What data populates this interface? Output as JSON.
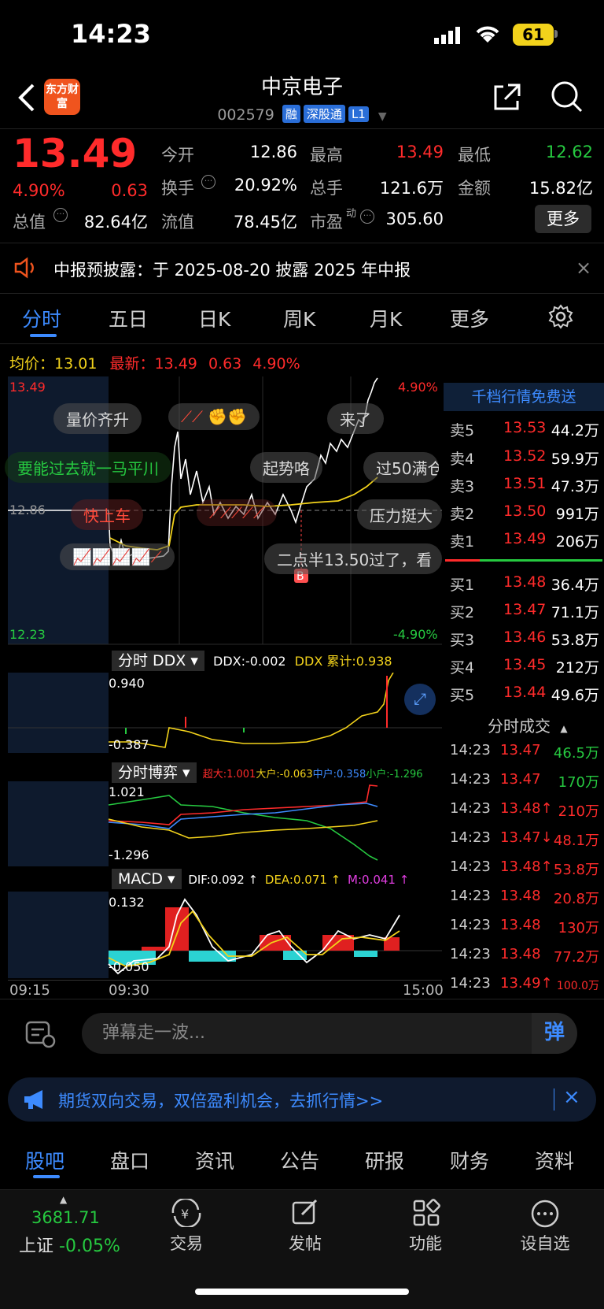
{
  "status": {
    "time": "14:23",
    "battery": "61"
  },
  "header": {
    "logo_text": "东方财富",
    "title": "中京电子",
    "code": "002579",
    "tags": [
      "融",
      "深股通",
      "L1"
    ]
  },
  "quote": {
    "price": "13.49",
    "change_pct": "4.90%",
    "change_amt": "0.63",
    "fields": {
      "open_label": "今开",
      "open": "12.86",
      "high_label": "最高",
      "high": "13.49",
      "low_label": "最低",
      "low": "12.62",
      "turnover_label": "换手",
      "turnover": "20.92%",
      "volume_label": "总手",
      "volume": "121.6万",
      "amount_label": "金额",
      "amount": "15.82亿",
      "mktcap_label": "总值",
      "mktcap": "82.64亿",
      "float_label": "流值",
      "float": "78.45亿",
      "pe_label": "市盈",
      "pe_sup": "动",
      "pe": "305.60"
    },
    "more_label": "更多"
  },
  "notice": {
    "text": "中报预披露：于 2025-08-20 披露 2025 年中报"
  },
  "tabs": [
    "分时",
    "五日",
    "日K",
    "周K",
    "月K",
    "更多"
  ],
  "chart_header": {
    "avg_label": "均价：",
    "avg": "13.01",
    "latest_label": "最新：",
    "latest": "13.49",
    "latest_chg": "0.63",
    "latest_pct": "4.90%"
  },
  "chart_axis": {
    "top_price": "13.49",
    "top_pct": "4.90%",
    "mid_price": "12.86",
    "bottom_price": "12.23",
    "bottom_pct": "-4.90%",
    "times": [
      "09:15",
      "09:30",
      "15:00"
    ]
  },
  "danmu": [
    "量价齐升",
    "来了",
    "要能过去就一马平川",
    "起势咯",
    "过50满仓",
    "快上车",
    "压力挺大",
    "二点半13.50过了，看"
  ],
  "order_book_title": "千档行情免费送",
  "asks": [
    {
      "label": "卖5",
      "price": "13.53",
      "vol": "44.2万"
    },
    {
      "label": "卖4",
      "price": "13.52",
      "vol": "59.9万"
    },
    {
      "label": "卖3",
      "price": "13.51",
      "vol": "47.3万"
    },
    {
      "label": "卖2",
      "price": "13.50",
      "vol": "991万"
    },
    {
      "label": "卖1",
      "price": "13.49",
      "vol": "206万"
    }
  ],
  "bids": [
    {
      "label": "买1",
      "price": "13.48",
      "vol": "36.4万"
    },
    {
      "label": "买2",
      "price": "13.47",
      "vol": "71.1万"
    },
    {
      "label": "买3",
      "price": "13.46",
      "vol": "53.8万"
    },
    {
      "label": "买4",
      "price": "13.45",
      "vol": "212万"
    },
    {
      "label": "买5",
      "price": "13.44",
      "vol": "49.6万"
    }
  ],
  "trades_title": "分时成交",
  "trades": [
    {
      "t": "14:23",
      "p": "13.47",
      "v": "46.5万",
      "c": "green"
    },
    {
      "t": "14:23",
      "p": "13.47",
      "v": "170万",
      "c": "green"
    },
    {
      "t": "14:23",
      "p": "13.48↑",
      "v": "210万",
      "c": "red"
    },
    {
      "t": "14:23",
      "p": "13.47↓",
      "v": "48.1万",
      "c": "red"
    },
    {
      "t": "14:23",
      "p": "13.48↑",
      "v": "53.8万",
      "c": "red"
    },
    {
      "t": "14:23",
      "p": "13.48",
      "v": "20.8万",
      "c": "red"
    },
    {
      "t": "14:23",
      "p": "13.48",
      "v": "130万",
      "c": "red"
    },
    {
      "t": "14:23",
      "p": "13.48",
      "v": "77.2万",
      "c": "red"
    },
    {
      "t": "14:23",
      "p": "13.49↑",
      "v": "100.0万",
      "c": "red"
    }
  ],
  "ddx": {
    "selector": "分时 DDX",
    "ddx_text": "DDX:-0.002",
    "ddx_cum_text": "DDX 累计:0.938",
    "top": "0.940",
    "bottom": "-0.387"
  },
  "bo": {
    "selector": "分时博弈",
    "super": "超大:1.001",
    "large": "大户:-0.063",
    "mid": "中户:0.358",
    "small": "小户:-1.296",
    "top": "1.021",
    "bottom": "-1.296"
  },
  "macd": {
    "selector": "MACD",
    "dif": "DIF:0.092 ↑",
    "dea": "DEA:0.071 ↑",
    "m": "M:0.041 ↑",
    "top": "0.132",
    "bottom": "-0.050"
  },
  "bottom": {
    "danmu_placeholder": "弹幕走一波...",
    "danmu_btn": "弹",
    "ad_text": "期货双向交易，双倍盈利机会，去抓行情>>",
    "tabs": [
      "股吧",
      "盘口",
      "资讯",
      "公告",
      "研报",
      "财务",
      "资料"
    ],
    "index_value": "3681.71",
    "index_label": "上证",
    "index_change": "-0.05%",
    "nav": [
      "交易",
      "发帖",
      "功能",
      "设自选"
    ]
  },
  "colors": {
    "up": "#ff2b2b",
    "down": "#26c940",
    "accent": "#3d8bff",
    "avg": "#f2d21b"
  }
}
